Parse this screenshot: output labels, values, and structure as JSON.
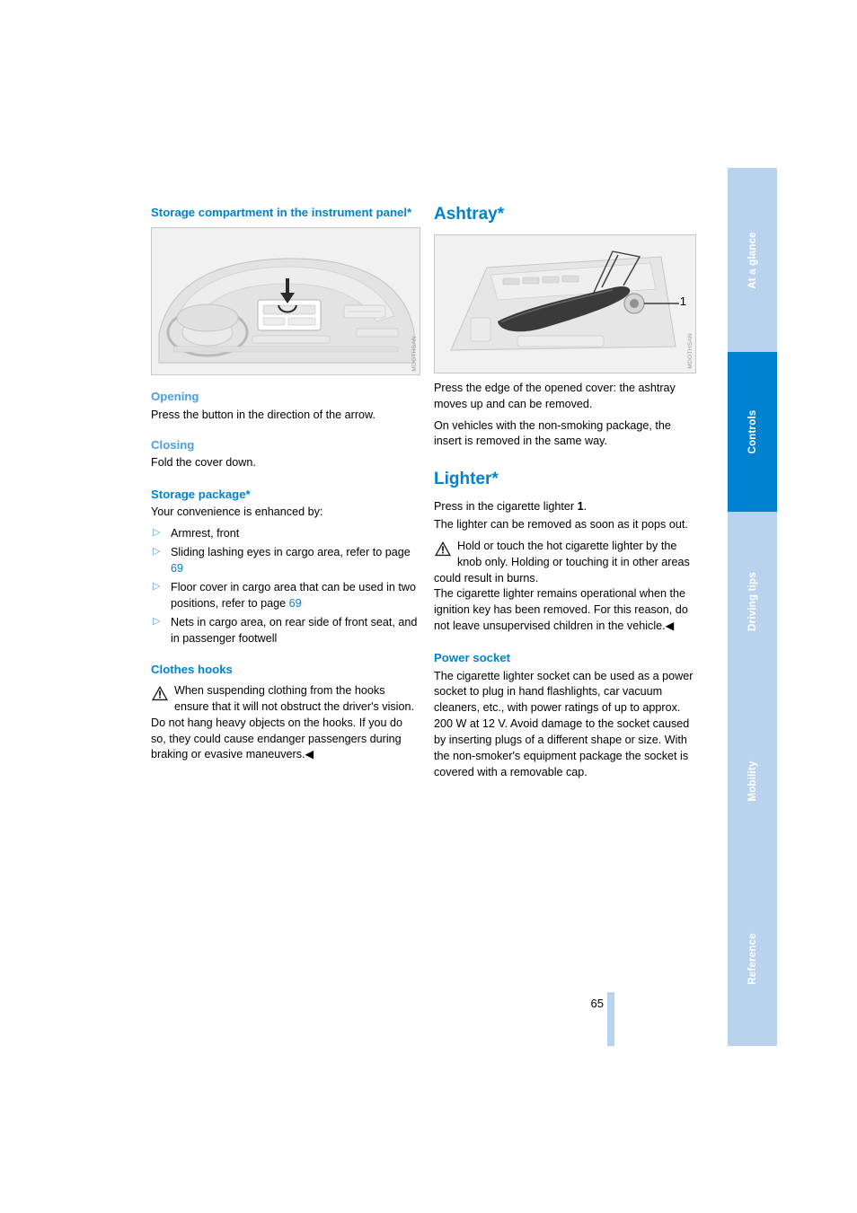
{
  "page": {
    "number": "65"
  },
  "tabs": [
    {
      "label": "At a glance",
      "active": false
    },
    {
      "label": "Controls",
      "active": true
    },
    {
      "label": "Driving tips",
      "active": false
    },
    {
      "label": "Mobility",
      "active": false
    },
    {
      "label": "Reference",
      "active": false
    }
  ],
  "left_column": {
    "heading": "Storage compartment in the instrument panel*",
    "figure_code": "MDOTHSAN",
    "opening_heading": "Opening",
    "opening_text": "Press the button in the direction of the arrow.",
    "closing_heading": "Closing",
    "closing_text": "Fold the cover down.",
    "storage_package_heading": "Storage package*",
    "storage_package_intro": "Your convenience is enhanced by:",
    "storage_items": [
      {
        "text": "Armrest, front"
      },
      {
        "text": "Sliding lashing eyes in cargo area, refer to page ",
        "link": "69"
      },
      {
        "text": "Floor cover in cargo area that can be used in two positions, refer to page ",
        "link": "69"
      },
      {
        "text": "Nets in cargo area, on rear side of front seat, and in passenger footwell"
      }
    ],
    "clothes_hooks_heading": "Clothes hooks",
    "clothes_hooks_warning": "When suspending clothing from the hooks ensure that it will not obstruct the driver's vision. Do not hang heavy objects on the hooks. If you do so, they could cause endanger passengers during braking or evasive maneuvers.◀"
  },
  "right_column": {
    "ashtray_heading": "Ashtray*",
    "figure_code": "MDOTHSAN",
    "callout_1": "1",
    "ashtray_p1": "Press the edge of the opened cover: the ashtray moves up and can be removed.",
    "ashtray_p2": "On vehicles with the non-smoking package, the insert is removed in the same way.",
    "lighter_heading": "Lighter*",
    "lighter_p1_pre": "Press in the cigarette lighter ",
    "lighter_p1_bold": "1",
    "lighter_p1_post": ".",
    "lighter_p2": "The lighter can be removed as soon as it pops out.",
    "lighter_warning": "Hold or touch the hot cigarette lighter by the knob only. Holding or touching it in other areas could result in burns.",
    "lighter_p3": "The cigarette lighter remains operational when the ignition key has been removed. For this reason, do not leave unsupervised children in the vehicle.◀",
    "power_socket_heading": "Power socket",
    "power_socket_text": "The cigarette lighter socket can be used as a power socket to plug in hand flashlights, car vacuum cleaners, etc., with power ratings of up to approx. 200 W at 12 V. Avoid damage to the socket caused by inserting plugs of a different shape or size. With the non-smoker's equipment package the socket is covered with a removable cap."
  },
  "colors": {
    "accent": "#0082d0",
    "tab_inactive": "#b9d3ee",
    "sub_heading": "#4a9fe0"
  }
}
